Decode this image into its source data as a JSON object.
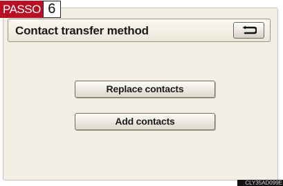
{
  "step": {
    "label": "PASSO",
    "number": "6"
  },
  "header": {
    "title": "Contact transfer method",
    "back_icon": "return-arrow-icon"
  },
  "actions": {
    "replace_label": "Replace contacts",
    "add_label": "Add contacts"
  },
  "image_code": "CLY35AD099E",
  "colors": {
    "step_badge": "#b80f24",
    "screen_background": "#f3efe4"
  }
}
